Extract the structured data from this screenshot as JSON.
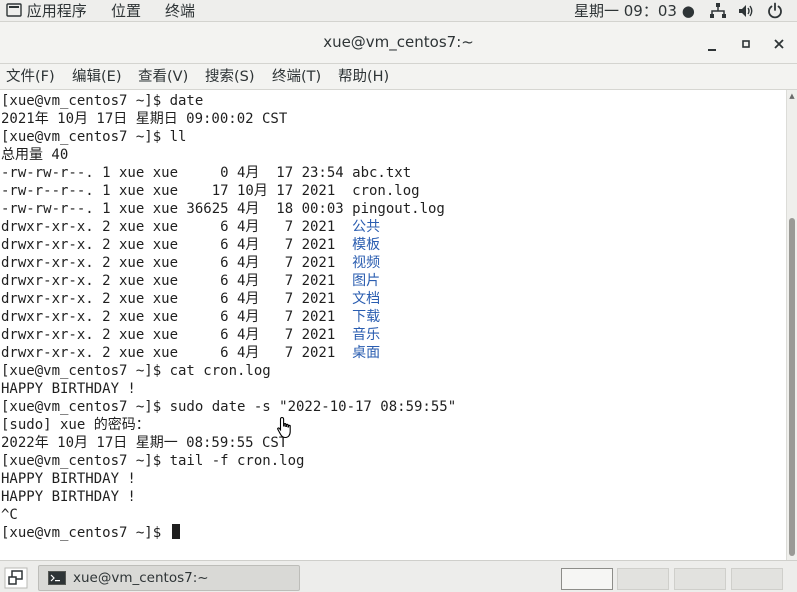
{
  "topbar": {
    "applications": "应用程序",
    "places": "位置",
    "terminal_app": "终端",
    "clock": "星期一 09：03 ●",
    "icons": [
      "network-icon",
      "volume-icon",
      "power-icon"
    ]
  },
  "window": {
    "title": "xue@vm_centos7:~",
    "buttons": {
      "minimize": "—",
      "maximize": "▪",
      "close": "✕"
    }
  },
  "menubar": {
    "items": [
      "文件(F)",
      "编辑(E)",
      "查看(V)",
      "搜索(S)",
      "终端(T)",
      "帮助(H)"
    ]
  },
  "terminal": {
    "colors": {
      "text": "#1f1f1f",
      "directory": "#2a5db0"
    },
    "lines": [
      {
        "text": "[xue@vm_centos7 ~]$ date"
      },
      {
        "text": "2021年 10月 17日 星期日 09:00:02 CST"
      },
      {
        "text": "[xue@vm_centos7 ~]$ ll"
      },
      {
        "text": "总用量 40"
      },
      {
        "text": "-rw-rw-r--. 1 xue xue     0 4月  17 23:54 abc.txt"
      },
      {
        "text": "-rw-r--r--. 1 xue xue    17 10月 17 2021  cron.log"
      },
      {
        "text": "-rw-rw-r--. 1 xue xue 36625 4月  18 00:03 pingout.log"
      },
      {
        "text": "drwxr-xr-x. 2 xue xue     6 4月   7 2021  ",
        "dir": "公共"
      },
      {
        "text": "drwxr-xr-x. 2 xue xue     6 4月   7 2021  ",
        "dir": "模板"
      },
      {
        "text": "drwxr-xr-x. 2 xue xue     6 4月   7 2021  ",
        "dir": "视频"
      },
      {
        "text": "drwxr-xr-x. 2 xue xue     6 4月   7 2021  ",
        "dir": "图片"
      },
      {
        "text": "drwxr-xr-x. 2 xue xue     6 4月   7 2021  ",
        "dir": "文档"
      },
      {
        "text": "drwxr-xr-x. 2 xue xue     6 4月   7 2021  ",
        "dir": "下载"
      },
      {
        "text": "drwxr-xr-x. 2 xue xue     6 4月   7 2021  ",
        "dir": "音乐"
      },
      {
        "text": "drwxr-xr-x. 2 xue xue     6 4月   7 2021  ",
        "dir": "桌面"
      },
      {
        "text": "[xue@vm_centos7 ~]$ cat cron.log"
      },
      {
        "text": "HAPPY BIRTHDAY !"
      },
      {
        "text": "[xue@vm_centos7 ~]$ sudo date -s \"2022-10-17 08:59:55\""
      },
      {
        "text": "[sudo] xue 的密码："
      },
      {
        "text": "2022年 10月 17日 星期一 08:59:55 CST"
      },
      {
        "text": "[xue@vm_centos7 ~]$ tail -f cron.log"
      },
      {
        "text": "HAPPY BIRTHDAY !"
      },
      {
        "text": "HAPPY BIRTHDAY !"
      },
      {
        "text": "^C"
      },
      {
        "text": "[xue@vm_centos7 ~]$ ",
        "cursor": true
      }
    ]
  },
  "taskbar": {
    "window_label": "xue@vm_centos7:~",
    "workspaces": 4,
    "active_workspace": 1
  }
}
